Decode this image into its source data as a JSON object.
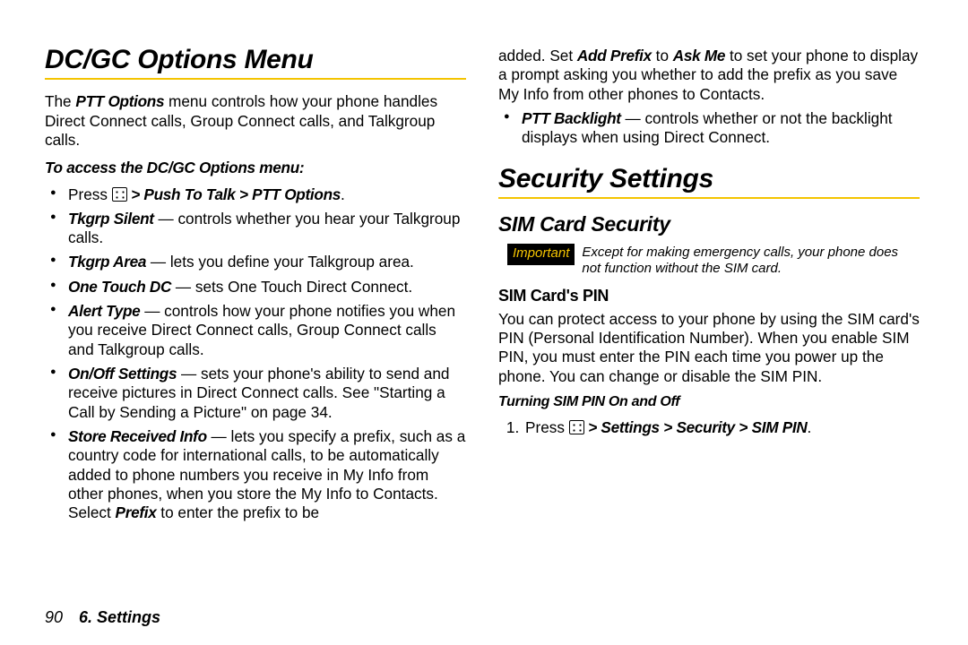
{
  "left": {
    "h1": "DC/GC Options Menu",
    "intro_a": "The ",
    "intro_b": "PTT Options",
    "intro_c": " menu controls how your phone handles Direct Connect calls, Group Connect calls, and Talkgroup calls.",
    "access": "To access the DC/GC Options menu:",
    "press_a": "Press ",
    "press_b": " > Push To Talk > PTT Options",
    "press_c": ".",
    "items": [
      {
        "t": "Tkgrp Silent",
        "d": " — controls whether you hear your Talkgroup calls."
      },
      {
        "t": "Tkgrp Area",
        "d": " — lets you define your Talkgroup area."
      },
      {
        "t": "One Touch DC",
        "d": " — sets One Touch Direct Connect."
      },
      {
        "t": "Alert Type",
        "d": " — controls how your phone notifies you when you receive Direct Connect calls, Group Connect calls and Talkgroup calls."
      },
      {
        "t": "On/Off Settings",
        "d": " — sets your phone's ability to send and receive pictures in Direct Connect calls. See \"Starting a Call by Sending a Picture\" on page 34."
      }
    ],
    "store_t": "Store Received Info",
    "store_d1": " — lets you specify a prefix, such as a country code for international calls, to be automatically added to phone numbers you receive in My Info from other phones, when you store the My Info to Contacts. Select ",
    "store_d2": "Prefix",
    "store_d3": " to enter the prefix to be"
  },
  "right": {
    "cont1a": "added. Set ",
    "cont1b": "Add Prefix",
    "cont1c": " to ",
    "cont1d": "Ask Me",
    "cont1e": " to set your phone to display a prompt asking you whether to add the prefix as you save My Info from other phones to Contacts.",
    "ptt_t": "PTT Backlight",
    "ptt_d": " — controls whether or not the backlight displays when using Direct Connect.",
    "h1": "Security Settings",
    "h2": "SIM Card Security",
    "important_label": "Important",
    "important_text": "Except for making emergency calls, your phone does not function without the SIM card.",
    "h3": "SIM Card's PIN",
    "simpara": "You can protect access to your phone by using the SIM card's PIN (Personal Identification Number). When you enable SIM PIN, you must enter the PIN each time you power up the phone. You can change or disable the SIM PIN.",
    "turning": "Turning SIM PIN On and Off",
    "step1a": "Press ",
    "step1b": " > Settings > Security > SIM PIN",
    "step1c": "."
  },
  "footer": {
    "page": "90",
    "chapter": "6. Settings"
  }
}
